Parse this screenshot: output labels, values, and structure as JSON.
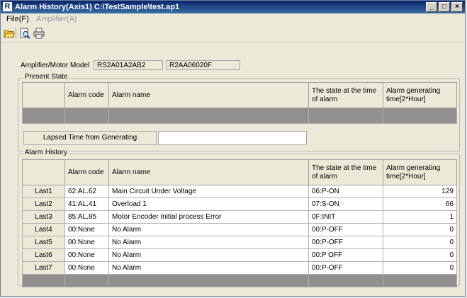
{
  "window": {
    "title": "Alarm History(Axis1) C:\\TestSample\\test.ap1",
    "minimize": "_",
    "maximize": "□",
    "close": "×"
  },
  "menu": {
    "file": "File(F)",
    "amplifier": "Amplifier(A)"
  },
  "model": {
    "label": "Amplifier/Motor Model",
    "amplifier": "RS2A01A2AB2",
    "motor": "R2AA06020F"
  },
  "present_state": {
    "legend": "Present State",
    "headers": {
      "code": "Alarm code",
      "name": "Alarm name",
      "state": "The state at the time of alarm",
      "time": "Alarm generating time[2*Hour]"
    },
    "lapsed_label": "Lapsed Time from Generating",
    "lapsed_value": ""
  },
  "alarm_history": {
    "legend": "Alarm History",
    "headers": {
      "code": "Alarm code",
      "name": "Alarm name",
      "state": "The state at the time of alarm",
      "time": "Alarm generating time[2*Hour]"
    },
    "rows": [
      {
        "label": "Last1",
        "code": "62:AL.62",
        "name": "Main Circuit Under Voltage",
        "state": "06:P-ON",
        "time": "129"
      },
      {
        "label": "Last2",
        "code": "41:AL.41",
        "name": "Overload 1",
        "state": "07:S-ON",
        "time": "66"
      },
      {
        "label": "Last3",
        "code": "85:AL.85",
        "name": "Motor Encoder Initial process Error",
        "state": "0F:INIT",
        "time": "1"
      },
      {
        "label": "Last4",
        "code": "00:None",
        "name": "No Alarm",
        "state": "00:P-OFF",
        "time": "0"
      },
      {
        "label": "Last5",
        "code": "00:None",
        "name": "No Alarm",
        "state": "00:P-OFF",
        "time": "0"
      },
      {
        "label": "Last6",
        "code": "00:None",
        "name": "No Alarm",
        "state": "00:P OFF",
        "time": "0"
      },
      {
        "label": "Last7",
        "code": "00:None",
        "name": "No Alarm",
        "state": "00:P-OFF",
        "time": "0"
      }
    ]
  },
  "icons": [
    "open-folder-icon",
    "print-preview-icon",
    "print-icon"
  ]
}
